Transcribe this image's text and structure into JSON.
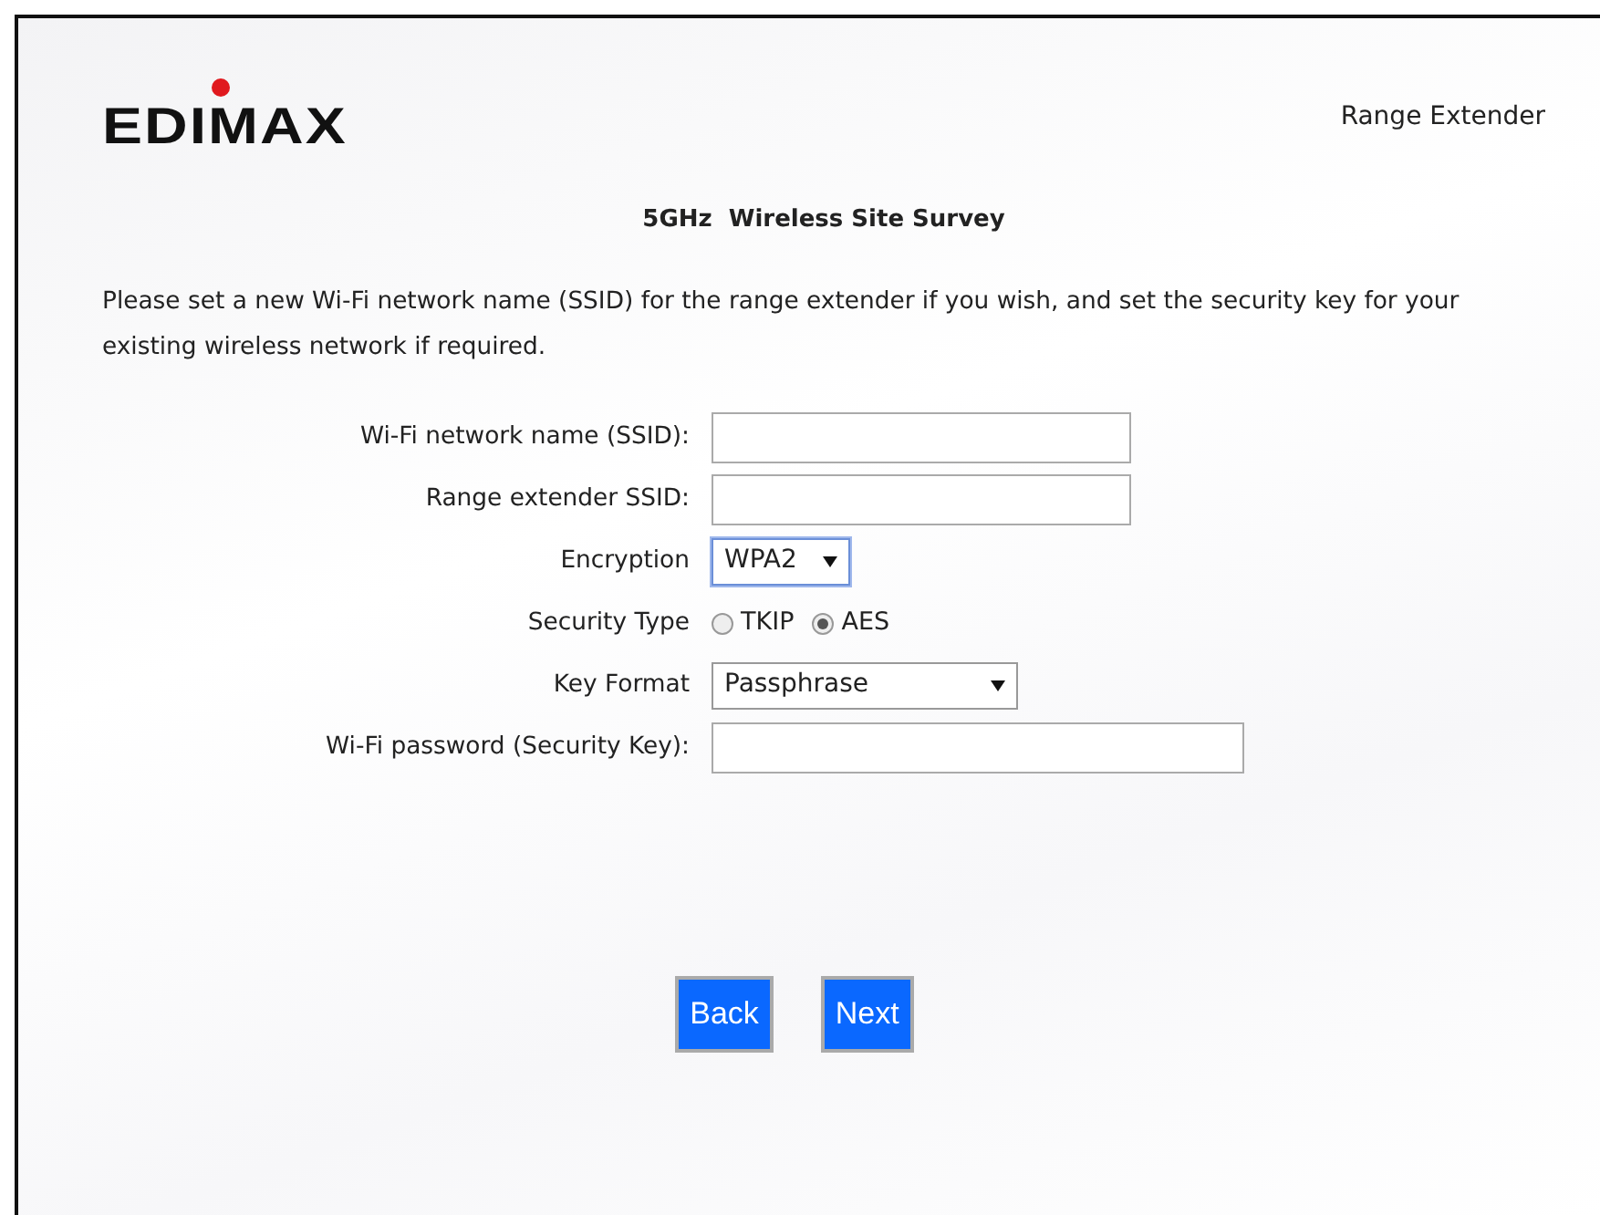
{
  "header": {
    "logo": "EDIMAX",
    "product": "Range Extender"
  },
  "title": "5GHz  Wireless Site Survey",
  "intro": "Please set a new Wi-Fi network name (SSID) for the range extender if you wish, and set the security key for your existing wireless network if required.",
  "fields": [
    {
      "kind": "text",
      "label": "Wi-Fi network name (SSID):"
    },
    {
      "kind": "text",
      "label": "Range extender SSID:"
    },
    {
      "kind": "select",
      "label": "Encryption",
      "value": "WPA2",
      "focused": true
    },
    {
      "kind": "radio",
      "label": "Security Type",
      "options": [
        {
          "label": "TKIP",
          "selected": false
        },
        {
          "label": "AES",
          "selected": true
        }
      ]
    },
    {
      "kind": "select",
      "label": "Key Format",
      "value": "Passphrase",
      "focused": false
    },
    {
      "kind": "text",
      "label": "Wi-Fi password (Security Key):",
      "wide": true
    }
  ],
  "buttons": [
    "Back",
    "Next"
  ]
}
